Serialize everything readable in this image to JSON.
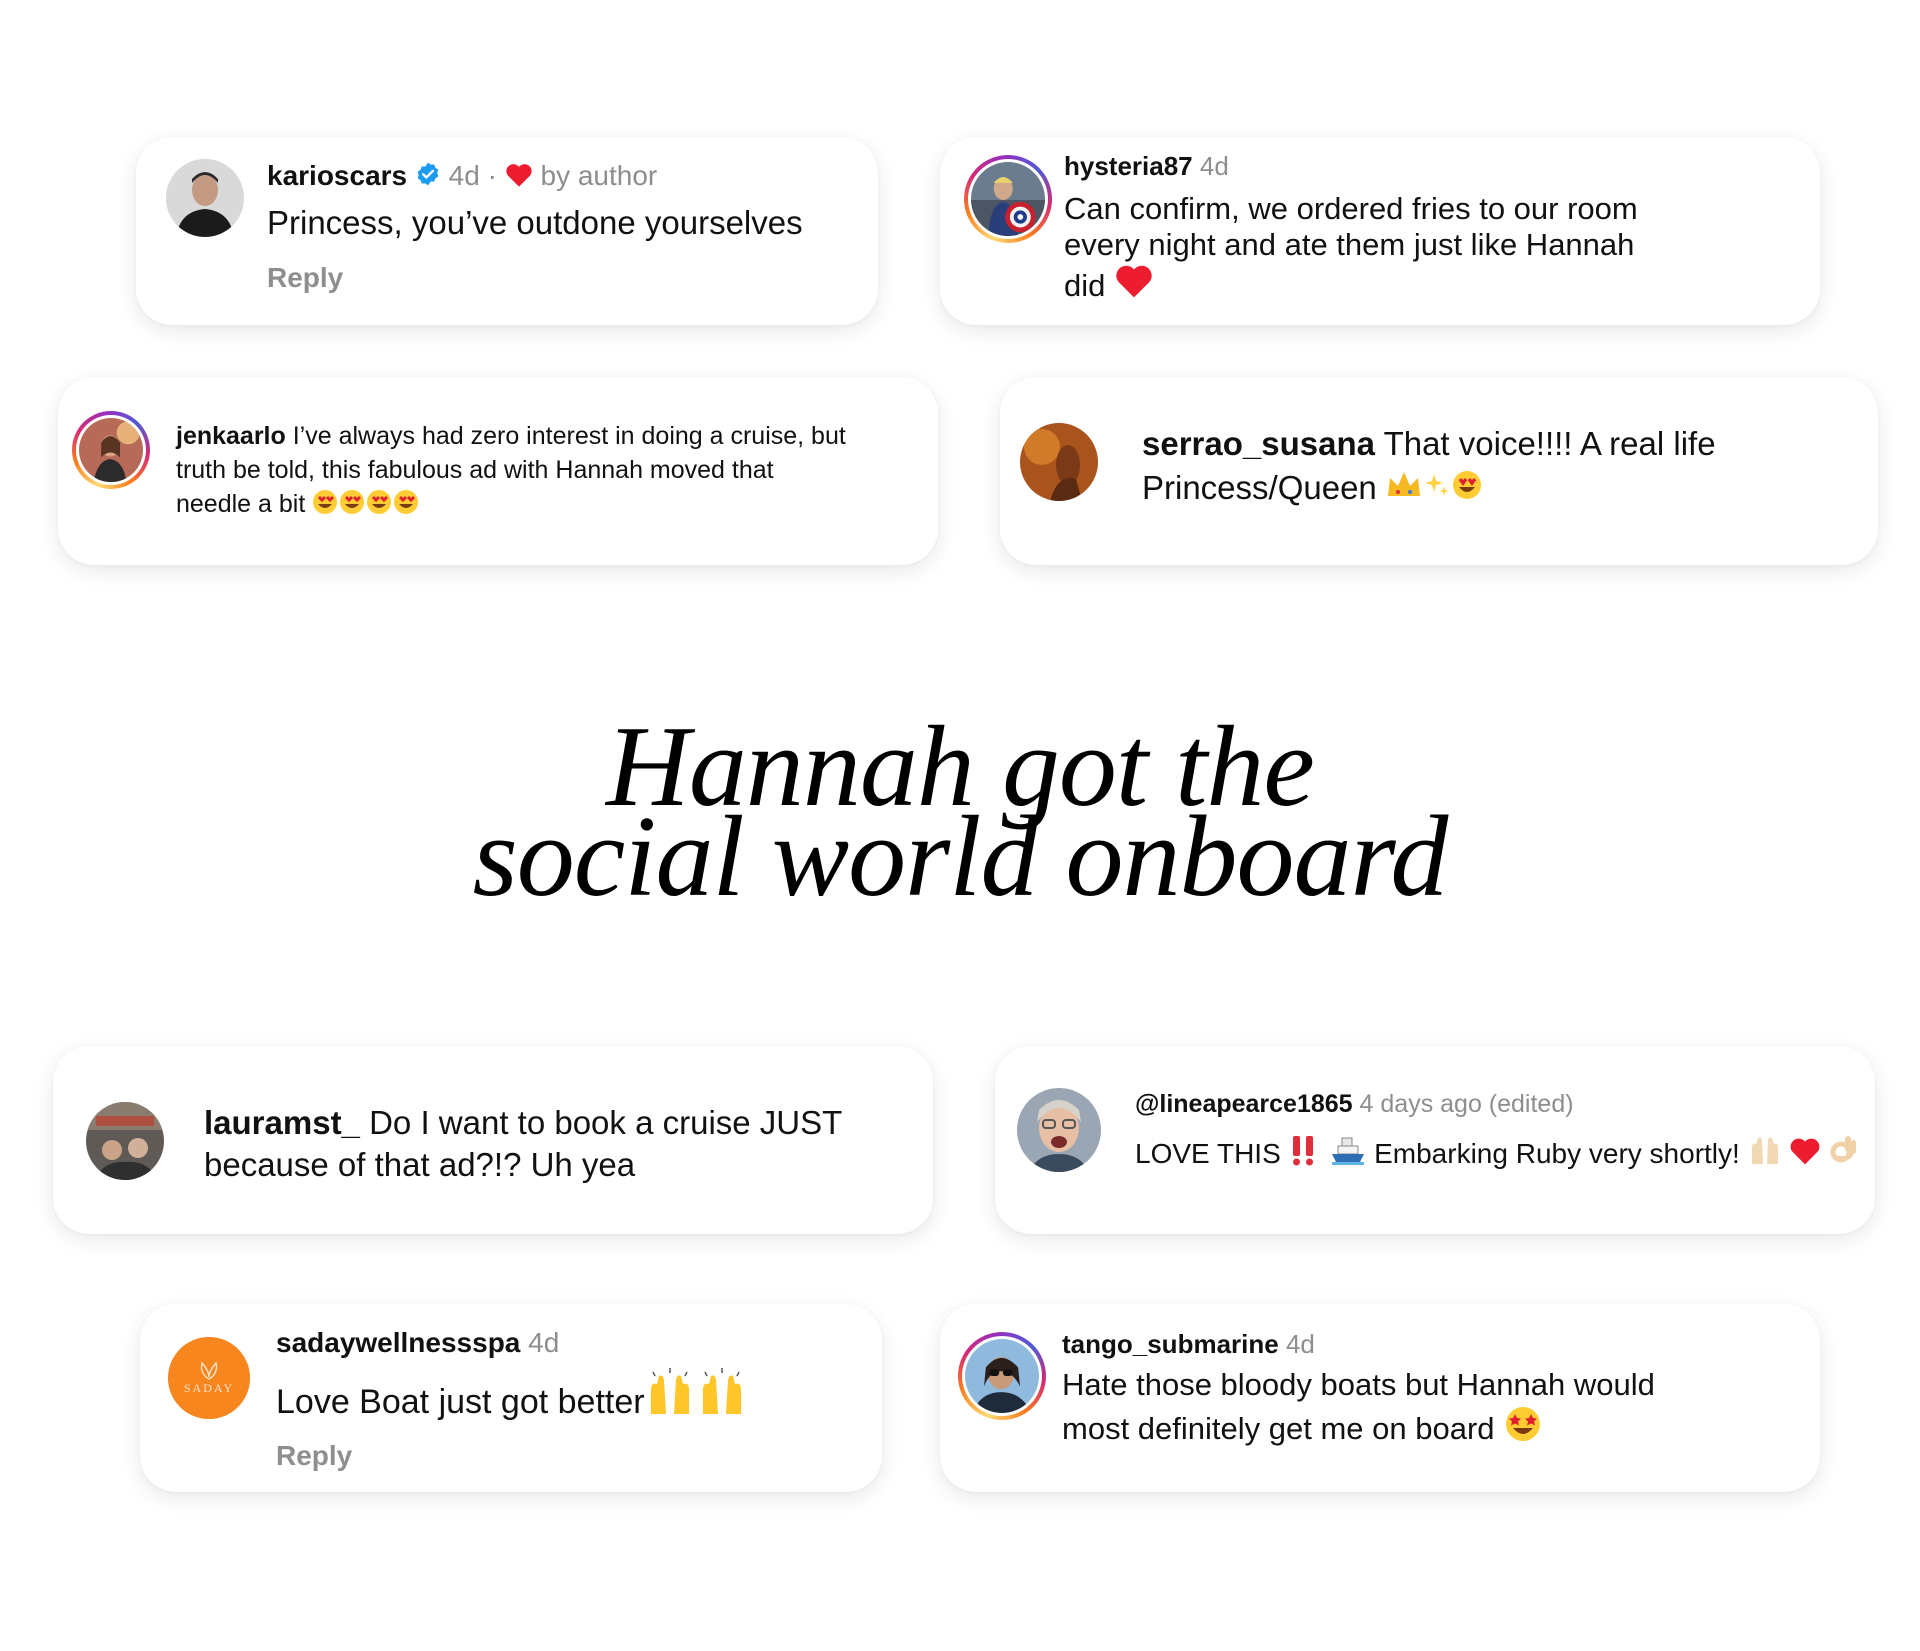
{
  "headline": {
    "line1": "Hannah got the",
    "line2": "social world onboard"
  },
  "comments": [
    {
      "username": "karioscars",
      "time": "4d",
      "liked_label": "by author",
      "text": "Princess, you’ve outdone yourselves",
      "reply_label": "Reply"
    },
    {
      "username": "hysteria87",
      "time": "4d",
      "text_line1": "Can confirm, we ordered fries to our room",
      "text_line2": "every night and ate them just like Hannah",
      "text_line3": "did"
    },
    {
      "username": "jenkaarlo",
      "text_line1": "I’ve always had zero interest in doing a cruise, but",
      "text_line2": "truth be told, this fabulous ad with Hannah moved that",
      "text_line3": "needle a bit"
    },
    {
      "username": "serrao_susana",
      "text_line1": "That voice!!!! A real life",
      "text_line2": "Princess/Queen"
    },
    {
      "username": "lauramst_",
      "text_line1": "Do I want to book a cruise JUST",
      "text_line2": "because of that ad?!? Uh yea"
    },
    {
      "username": "@lineapearce1865",
      "time": "4 days ago (edited)",
      "text_part1": "LOVE THIS",
      "text_part2": "Embarking Ruby very shortly!"
    },
    {
      "username": "sadaywellnessspa",
      "time": "4d",
      "text": "Love Boat just got better",
      "reply_label": "Reply",
      "avatar_text": "SADAY"
    },
    {
      "username": "tango_submarine",
      "time": "4d",
      "text_line1": "Hate those bloody boats but Hannah would",
      "text_line2": "most definitely get me on board"
    }
  ],
  "colors": {
    "heart": "#ed1c2e",
    "verified": "#1d9bf0",
    "saday_orange": "#f7861e",
    "meta_gray": "#8e8e8e"
  }
}
